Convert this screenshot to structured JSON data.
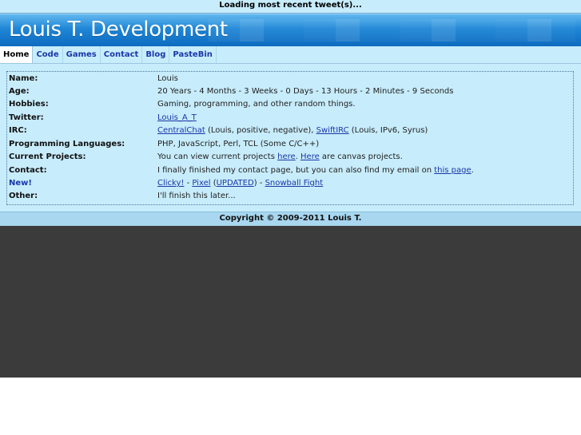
{
  "tweet_bar": {
    "text": "Loading most recent tweet(s)..."
  },
  "header": {
    "title": "Louis T. Development"
  },
  "nav": {
    "tabs": [
      {
        "label": "Home"
      },
      {
        "label": "Code"
      },
      {
        "label": "Games"
      },
      {
        "label": "Contact"
      },
      {
        "label": "Blog"
      },
      {
        "label": "PasteBin"
      }
    ],
    "active": "Home"
  },
  "info": {
    "name": {
      "label": "Name:",
      "value": "Louis"
    },
    "age": {
      "label": "Age:",
      "value": "20 Years - 4 Months - 3 Weeks - 0 Days - 13 Hours - 2 Minutes - 9 Seconds"
    },
    "hobbies": {
      "label": "Hobbies:",
      "value": "Gaming, programming, and other random things."
    },
    "twitter": {
      "label": "Twitter:",
      "link": "Louis_A_T"
    },
    "irc": {
      "label": "IRC:",
      "link1": "CentralChat",
      "text1": " (Louis, positive, negative), ",
      "link2": "SwiftIRC",
      "text2": " (Louis, IPv6, Syrus)"
    },
    "languages": {
      "label": "Programming Languages:",
      "value": "PHP, JavaScript, Perl, TCL (Some C/C++)"
    },
    "projects": {
      "label": "Current Projects:",
      "text1": "You can view current projects ",
      "link1": "here",
      "text2": ". ",
      "link2": "Here",
      "text3": " are canvas projects."
    },
    "contact": {
      "label": "Contact:",
      "text1": "I finally finished my contact page, but you can also find my email on ",
      "link1": "this page",
      "text2": "."
    },
    "new": {
      "label": "New!",
      "link1": "Clicky!",
      "sep1": " - ",
      "link2": "Pixel",
      "text2a": " (",
      "link3": "UPDATED",
      "text2b": ") - ",
      "link4": "Snowball Fight"
    },
    "other": {
      "label": "Other:",
      "value": "I'll finish this later..."
    }
  },
  "footer": {
    "text": "Copyright © 2009-2011 Louis T."
  },
  "colors": {
    "header_blue": "#1f86d6",
    "light_blue": "#c7ecfb",
    "link": "#1a37a8",
    "dark_bg": "#3b3b3b"
  }
}
